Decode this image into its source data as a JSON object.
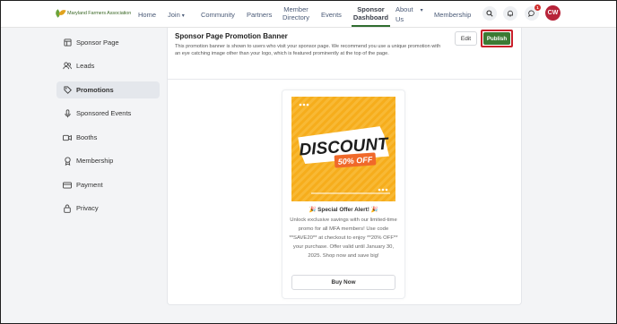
{
  "header": {
    "logo_text": "Maryland Farmers Association",
    "nav": [
      {
        "label": "Home"
      },
      {
        "label": "Join"
      },
      {
        "label": "Community"
      },
      {
        "label": "Partners"
      },
      {
        "line1": "Member",
        "line2": "Directory"
      },
      {
        "label": "Events"
      },
      {
        "line1": "Sponsor",
        "line2": "Dashboard"
      },
      {
        "line1": "About",
        "line2": "Us"
      },
      {
        "label": "Membership"
      }
    ],
    "notification_count": "1",
    "avatar_initials": "CW"
  },
  "sidebar": {
    "items": [
      {
        "label": "Sponsor Page",
        "icon": "layout-icon"
      },
      {
        "label": "Leads",
        "icon": "users-icon"
      },
      {
        "label": "Promotions",
        "icon": "tag-icon",
        "active": true
      },
      {
        "label": "Sponsored Events",
        "icon": "microphone-icon"
      },
      {
        "label": "Booths",
        "icon": "video-icon"
      },
      {
        "label": "Membership",
        "icon": "award-icon"
      },
      {
        "label": "Payment",
        "icon": "credit-card-icon"
      },
      {
        "label": "Privacy",
        "icon": "lock-icon"
      }
    ]
  },
  "main": {
    "title": "Sponsor Page Promotion Banner",
    "description": "This promotion banner is shown to users who visit your sponsor page. We recommend you use a unique promotion with an eye catching image other than your logo, which is featured prominently at the top of the page.",
    "edit_label": "Edit",
    "publish_label": "Publish"
  },
  "promo": {
    "image_headline": "DISCOUNT",
    "image_subline": "50% OFF",
    "title": "🎉 Special Offer Alert! 🎉",
    "body": "Unlock exclusive savings with our limited-time promo for all MFA members! Use code **SAVE20** at checkout to enjoy **20% OFF** your purchase. Offer valid until January 30, 2025. Shop now and save big!",
    "button_label": "Buy Now"
  },
  "colors": {
    "accent_green": "#3c7a34",
    "highlight_red": "#c81f2a",
    "avatar_red": "#b7243a",
    "promo_orange": "#f5a623"
  }
}
